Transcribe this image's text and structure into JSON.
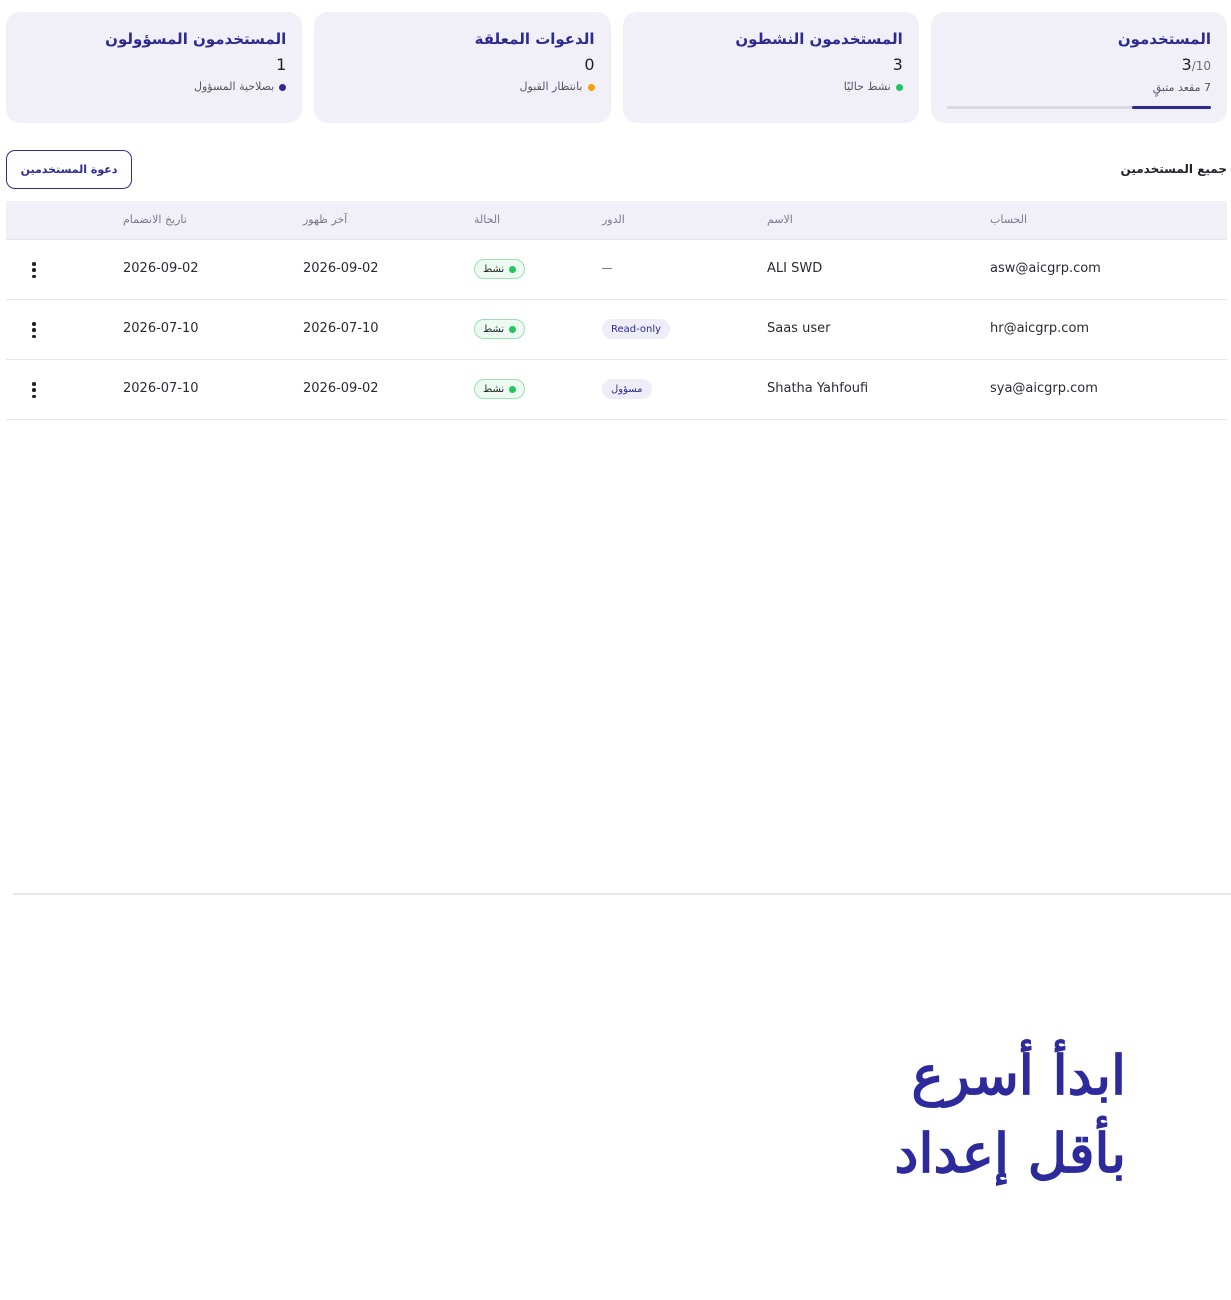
{
  "cards": [
    {
      "title": "المستخدمون",
      "value": "3",
      "total": "/10",
      "sub": "7 مقعد متبقٍ",
      "progress": 0.3,
      "accent": "#2d2b8f"
    },
    {
      "title": "المستخدمون النشطون",
      "value": "3",
      "sub": "نشط حاليًا",
      "dot_color": "#22c55e"
    },
    {
      "title": "الدعوات المعلقة",
      "value": "0",
      "sub": "بانتظار القبول",
      "dot_color": "#f59e0b"
    },
    {
      "title": "المستخدمون المسؤولون",
      "value": "1",
      "sub": "بصلاحية المسؤول",
      "dot_color": "#2d2b8f"
    }
  ],
  "section": {
    "title": "جميع المستخدمين",
    "invite_label": "دعوة المستخدمين"
  },
  "table": {
    "headers": {
      "account": "الحساب",
      "name": "الاسم",
      "role": "الدور",
      "status": "الحالة",
      "last_seen": "آخر ظهور",
      "joined": "تاريخ الانضمام"
    },
    "rows": [
      {
        "account": "asw@aicgrp.com",
        "name": "ALI SWD",
        "role": "",
        "status": "نشط",
        "last_seen": "2026-09-02",
        "joined": "2026-09-02"
      },
      {
        "account": "hr@aicgrp.com",
        "name": "Saas user",
        "role": "Read-only",
        "status": "نشط",
        "last_seen": "2026-07-10",
        "joined": "2026-07-10"
      },
      {
        "account": "sya@aicgrp.com",
        "name": "Shatha Yahfoufi",
        "role": "مسؤول",
        "status": "نشط",
        "last_seen": "2026-09-02",
        "joined": "2026-07-10"
      }
    ]
  },
  "promo": {
    "line1": "ابدأ أسرع",
    "line2": "بأقل إعداد"
  },
  "colors": {
    "accent": "#2d2b8f",
    "card_bg": "#f1f0f9",
    "active_green": "#22c55e",
    "pending_orange": "#f59e0b"
  }
}
